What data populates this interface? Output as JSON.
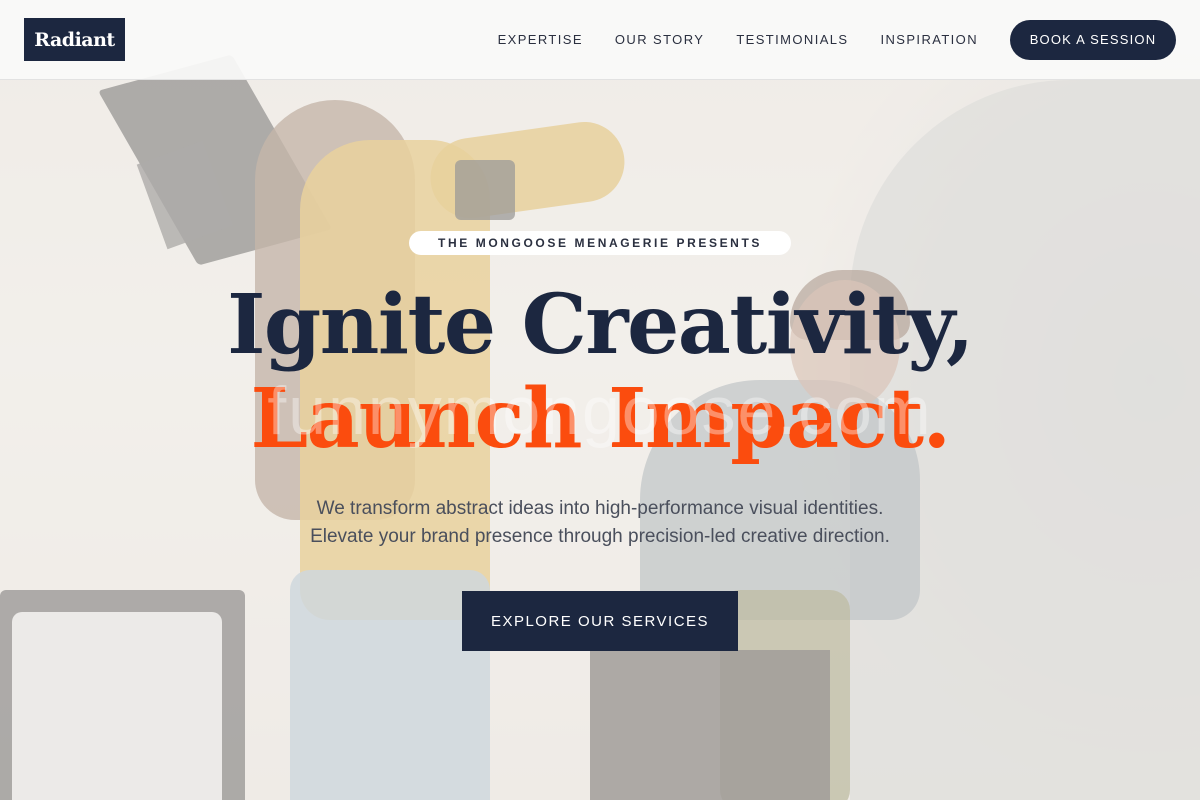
{
  "brand": {
    "logo_text": "Radiant"
  },
  "nav": {
    "items": [
      {
        "label": "EXPERTISE"
      },
      {
        "label": "OUR STORY"
      },
      {
        "label": "TESTIMONIALS"
      },
      {
        "label": "INSPIRATION"
      }
    ],
    "cta_label": "BOOK A SESSION"
  },
  "hero": {
    "eyebrow": "THE MONGOOSE MENAGERIE PRESENTS",
    "headline_line1": "Ignite Creativity,",
    "headline_line2": "Launch Impact.",
    "watermark": "funnymongoose.com",
    "subtext_line1": "We transform abstract ideas into high-performance visual identities.",
    "subtext_line2": "Elevate your brand presence through precision-led creative direction.",
    "button_label": "EXPLORE OUR SERVICES"
  },
  "colors": {
    "navy": "#1c2740",
    "accent_orange": "#fb4c0e",
    "header_bg": "#fafaf9"
  }
}
